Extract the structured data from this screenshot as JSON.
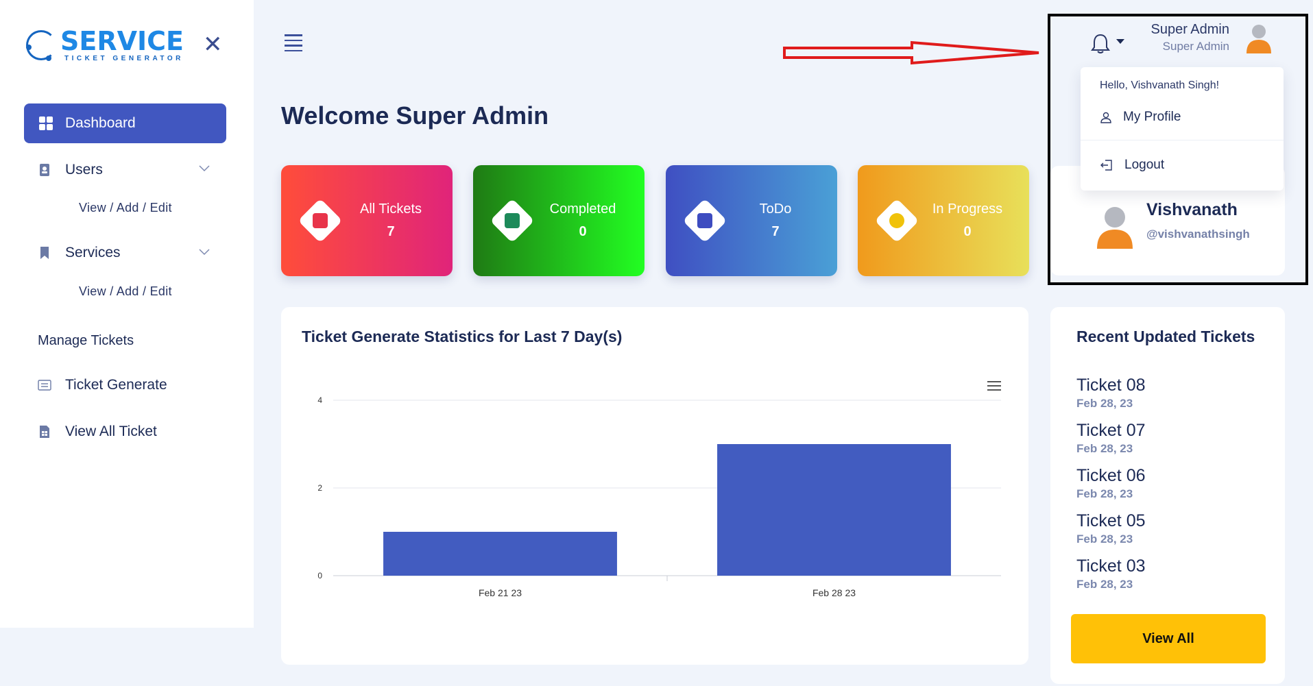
{
  "app": {
    "logo_main": "SERVICE",
    "logo_sub": "TICKET GENERATOR"
  },
  "sidebar": {
    "dashboard": "Dashboard",
    "users": "Users",
    "users_sub": "View / Add / Edit",
    "services": "Services",
    "services_sub": "View / Add / Edit",
    "manage_section": "Manage Tickets",
    "ticket_generate": "Ticket Generate",
    "view_all_ticket": "View All Ticket"
  },
  "header": {
    "user_name": "Super Admin",
    "user_role": "Super Admin"
  },
  "dropdown": {
    "hello": "Hello, Vishvanath Singh!",
    "my_profile": "My Profile",
    "logout": "Logout"
  },
  "main": {
    "welcome": "Welcome Super Admin"
  },
  "cards": [
    {
      "label": "All Tickets",
      "value": "7"
    },
    {
      "label": "Completed",
      "value": "0"
    },
    {
      "label": "ToDo",
      "value": "7"
    },
    {
      "label": "In Progress",
      "value": "0"
    }
  ],
  "profile": {
    "name": "Vishvanath",
    "handle": "@vishvanathsingh"
  },
  "chart_panel": {
    "title": "Ticket Generate Statistics for Last 7 Day(s)"
  },
  "chart_data": {
    "type": "bar",
    "title": "Ticket Generate Statistics for Last 7 Day(s)",
    "categories": [
      "Feb 21 23",
      "Feb 28 23"
    ],
    "values": [
      1,
      3
    ],
    "ylim": [
      0,
      4
    ],
    "yticks": [
      "4",
      "2",
      "0"
    ],
    "color": "#425cc0",
    "grid": true
  },
  "recent": {
    "title": "Recent Updated Tickets",
    "items": [
      {
        "title": "Ticket 08",
        "date": "Feb 28, 23"
      },
      {
        "title": "Ticket 07",
        "date": "Feb 28, 23"
      },
      {
        "title": "Ticket 06",
        "date": "Feb 28, 23"
      },
      {
        "title": "Ticket 05",
        "date": "Feb 28, 23"
      },
      {
        "title": "Ticket 03",
        "date": "Feb 28, 23"
      }
    ],
    "view_all": "View All"
  },
  "colors": {
    "accent": "#4157c0",
    "card_all": [
      "#ff4d3a",
      "#e0247a"
    ],
    "card_completed": [
      "#1f7a14",
      "#22ff22"
    ],
    "card_todo": [
      "#3f4fc2",
      "#4aa0d6"
    ],
    "card_progress": [
      "#f09a1c",
      "#e8e05a"
    ],
    "button": "#ffc107"
  }
}
